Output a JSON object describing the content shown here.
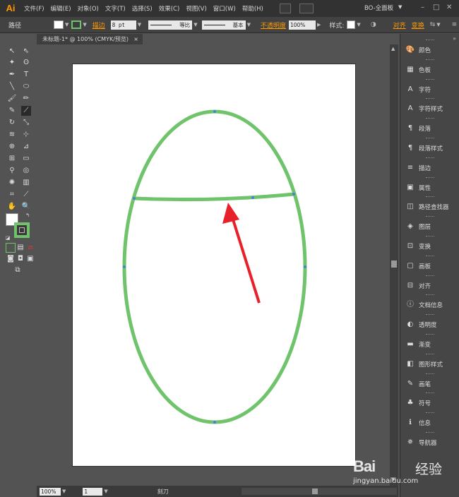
{
  "app": {
    "logo": "Ai",
    "menu": [
      "文件(F)",
      "编辑(E)",
      "对象(O)",
      "文字(T)",
      "选择(S)",
      "效果(C)",
      "视图(V)",
      "窗口(W)",
      "帮助(H)"
    ],
    "workspace": "BO-全面板",
    "window_buttons": [
      "–",
      "□",
      "✕"
    ]
  },
  "control_bar": {
    "selection_label": "路径",
    "stroke_label": "描边",
    "stroke_weight": "8 pt",
    "profile1": "等比",
    "profile2": "基本",
    "opacity_label": "不透明度",
    "opacity_value": "100%",
    "style_label": "样式:",
    "align_label": "对齐",
    "transform_label": "变换"
  },
  "document": {
    "tab_title": "未标题-1* @ 100% (CMYK/预览)",
    "close": "×"
  },
  "status_bar": {
    "zoom": "100%",
    "page": "1",
    "tool": "刻刀"
  },
  "colors": {
    "stroke_green": "#6fc36b",
    "arrow_red": "#e8202a",
    "accent_orange": "#ff9a00"
  },
  "panels": [
    {
      "icon": "palette-icon",
      "glyph": "🎨",
      "label": "颜色"
    },
    {
      "icon": "swatches-icon",
      "glyph": "▦",
      "label": "色板"
    },
    {
      "icon": "character-icon",
      "glyph": "A",
      "label": "字符"
    },
    {
      "icon": "character-style-icon",
      "glyph": "A",
      "label": "字符样式"
    },
    {
      "icon": "paragraph-icon",
      "glyph": "¶",
      "label": "段落"
    },
    {
      "icon": "paragraph-style-icon",
      "glyph": "¶",
      "label": "段落样式"
    },
    {
      "icon": "stroke-icon",
      "glyph": "≡",
      "label": "描边"
    },
    {
      "icon": "attributes-icon",
      "glyph": "▣",
      "label": "属性"
    },
    {
      "icon": "pathfinder-icon",
      "glyph": "◫",
      "label": "路径查找器"
    },
    {
      "icon": "layers-icon",
      "glyph": "◈",
      "label": "图层"
    },
    {
      "icon": "transform-icon",
      "glyph": "⊡",
      "label": "变换"
    },
    {
      "icon": "artboards-icon",
      "glyph": "▢",
      "label": "画板"
    },
    {
      "icon": "align-icon",
      "glyph": "⊟",
      "label": "对齐"
    },
    {
      "icon": "document-info-icon",
      "glyph": "ⓘ",
      "label": "文档信息"
    },
    {
      "icon": "transparency-icon",
      "glyph": "◐",
      "label": "透明度"
    },
    {
      "icon": "gradient-icon",
      "glyph": "▬",
      "label": "渐变"
    },
    {
      "icon": "graphic-styles-icon",
      "glyph": "◧",
      "label": "图形样式"
    },
    {
      "icon": "brushes-icon",
      "glyph": "✎",
      "label": "画笔"
    },
    {
      "icon": "symbols-icon",
      "glyph": "♣",
      "label": "符号"
    },
    {
      "icon": "info-icon",
      "glyph": "ℹ",
      "label": "信息"
    },
    {
      "icon": "navigator-icon",
      "glyph": "✵",
      "label": "导航器"
    }
  ],
  "watermark": {
    "brand": "Bai",
    "brand2": "经验",
    "url": "jingyan.baidu.com"
  }
}
